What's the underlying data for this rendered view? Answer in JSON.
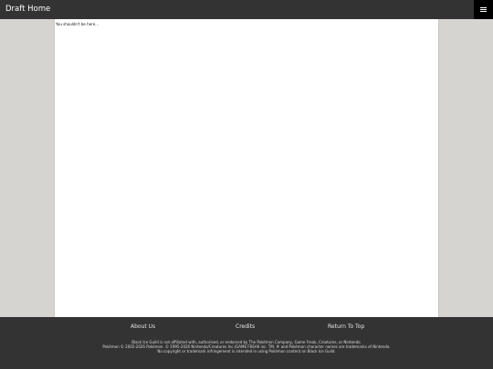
{
  "header": {
    "title": "Draft Home",
    "menu_icon": "hamburger-menu-icon"
  },
  "main": {
    "message": "You shouldn't be here..."
  },
  "footer": {
    "links": [
      {
        "label": "About Us"
      },
      {
        "label": "Credits"
      },
      {
        "label": "Return To Top"
      }
    ],
    "disclaimer": [
      "Black Ice Guild is not affiliated with, authorised, or endorsed by The Pokémon Company, Game Freak, Creatures, or Nintendo.",
      "Pokémon © 2002-2026 Pokémon. © 1995-2026 Nintendo/Creatures Inc./GAME FREAK inc. TM, ® and Pokémon character names are trademarks of Nintendo.",
      "No copyright or trademark infringement is intended in using Pokémon content on Black Ice Guild."
    ]
  },
  "colors": {
    "topbar": "#333333",
    "menu_button": "#000000",
    "gutter": "#d6d4d0",
    "content": "#ffffff",
    "footer": "#333333"
  }
}
